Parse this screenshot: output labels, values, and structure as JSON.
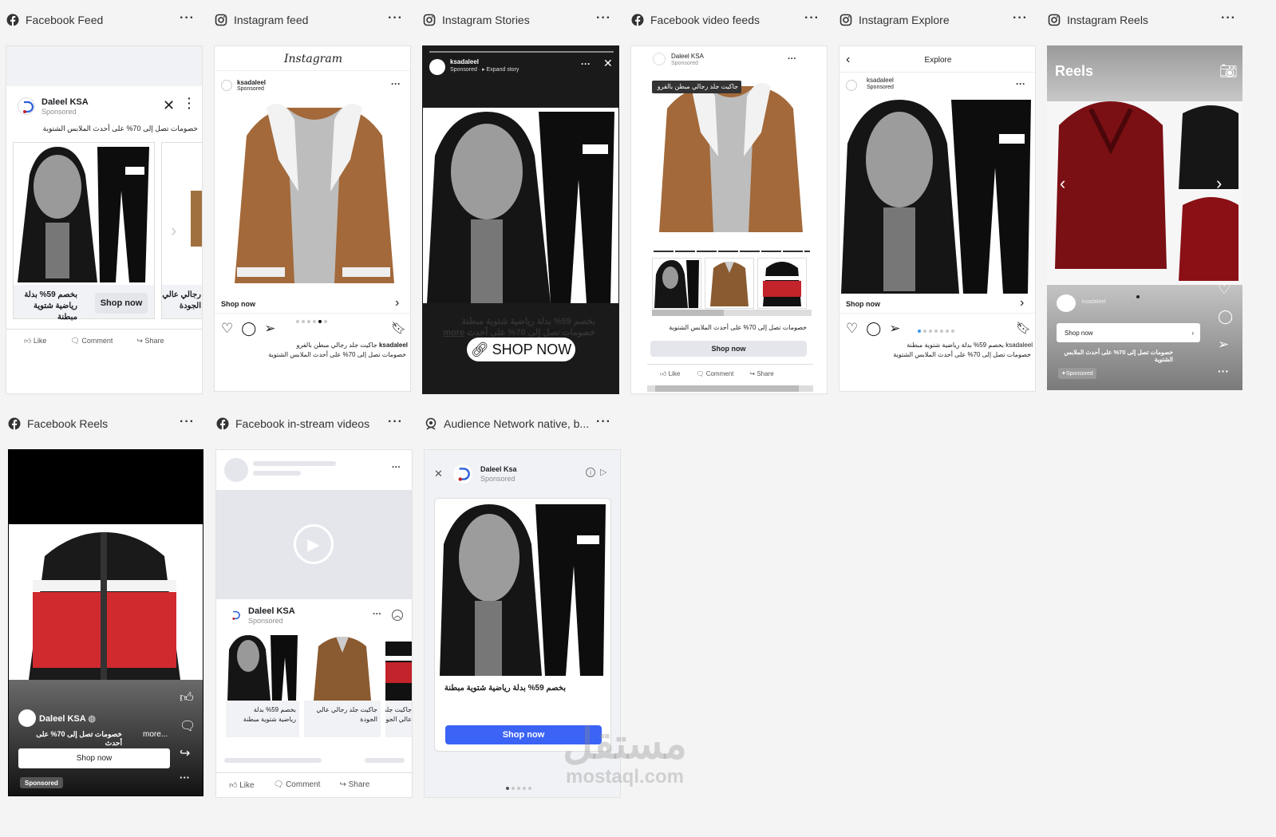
{
  "panels": {
    "fb_feed": {
      "title": "Facebook Feed",
      "menu": "···"
    },
    "ig_feed": {
      "title": "Instagram feed",
      "menu": "···"
    },
    "ig_stories": {
      "title": "Instagram Stories",
      "menu": "···"
    },
    "fb_video": {
      "title": "Facebook video feeds",
      "menu": "···"
    },
    "ig_explore": {
      "title": "Instagram Explore",
      "menu": "···"
    },
    "ig_reels": {
      "title": "Instagram Reels",
      "menu": "···"
    },
    "fb_reels": {
      "title": "Facebook Reels",
      "menu": "···"
    },
    "fb_instream": {
      "title": "Facebook in-stream videos",
      "menu": "···"
    },
    "an_native": {
      "title": "Audience Network native, b...",
      "menu": "···"
    }
  },
  "common": {
    "page_name": "Daleel KSA",
    "page_name_alt": "Daleel Ksa",
    "ig_handle": "ksadaleel",
    "sponsored": "Sponsored",
    "promo_text": "خصومات تصل إلى 70% على أحدث الملابس الشتوية",
    "promo_short": "خصومات تصل إلى 70% على أحدث",
    "card1_title": "بخصم 59% بدلة رياضية شتوية مبطنة",
    "card1_line1": "بخصم 59% بدلة",
    "card1_line2": "رياضية شتوية مبطنة",
    "card2_title": "جاكيت جلد رجالي عالي الجودة",
    "card2_line1": "جاكيت جلد رجالي عالي",
    "card2_line2": "الجودة",
    "caption_ig": "جاكيت جلد رجالي مبطن بالفرو",
    "shop_now": "Shop now",
    "shop_now_caps": "SHOP NOW",
    "like": "Like",
    "comment": "Comment",
    "share": "Share",
    "more": "more...",
    "more_short": "more",
    "instagram": "Instagram",
    "explore": "Explore",
    "reels": "Reels",
    "expand_story": "Expand story",
    "video_overlay": "جاكيت جلد رجالي مبطن بالفرو",
    "story_text_1": "بخصم 59% بدلة رياضية شتوية مبطنة",
    "story_text_2": "خصومات تصل إلى 70% على أحدث",
    "ig_explore_caption": "ksadaleel بخصم 59% بدلة رياضية شتوية مبطنة",
    "reels_sponsored": "Sponsored",
    "card3_partial_1": "جاكيت جلد",
    "card3_partial_2": "رجالي عالي"
  },
  "watermark": {
    "arabic": "مستقل",
    "latin": "mostaql.com"
  },
  "colors": {
    "blue": "#1877f2",
    "ig_blue": "#3897f0",
    "red": "#c3232a"
  }
}
